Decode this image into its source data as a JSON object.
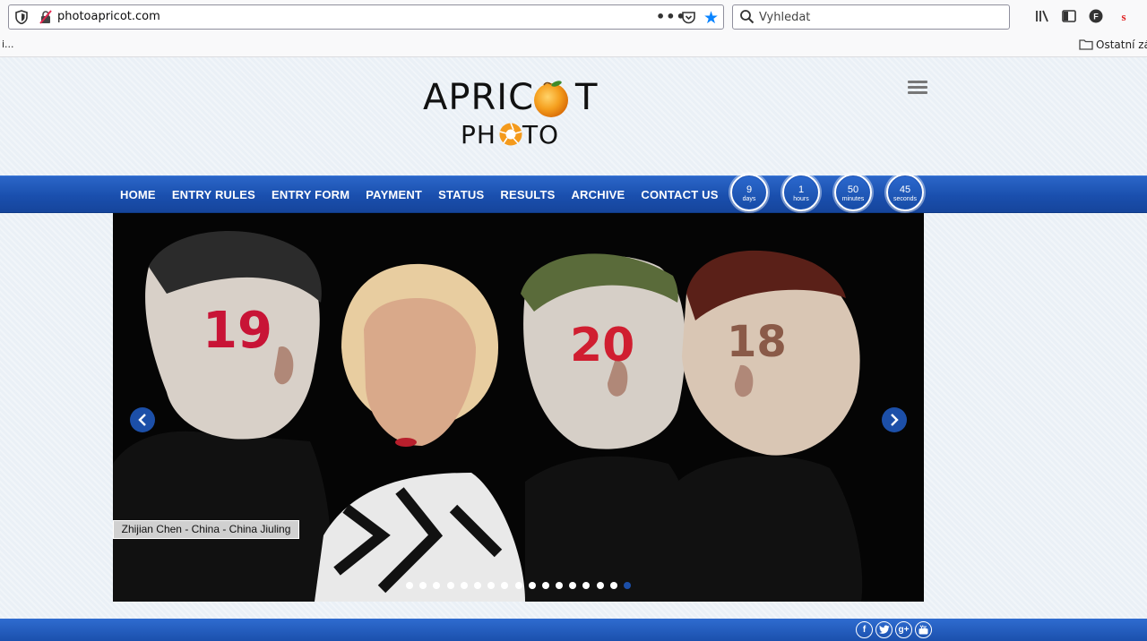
{
  "browser": {
    "url": "photoapricot.com",
    "more_label": "•••",
    "search_placeholder": "Vyhledat",
    "bookmarks_left": "i...",
    "bookmarks_other": "Ostatní zálo"
  },
  "header": {
    "logo_line1_a": "APRIC",
    "logo_line1_b": "T",
    "logo_line2_a": "PH",
    "logo_line2_b": "TO"
  },
  "nav": {
    "items": [
      {
        "label": "HOME"
      },
      {
        "label": "ENTRY RULES"
      },
      {
        "label": "ENTRY FORM"
      },
      {
        "label": "PAYMENT"
      },
      {
        "label": "STATUS"
      },
      {
        "label": "RESULTS"
      },
      {
        "label": "ARCHIVE"
      },
      {
        "label": "CONTACT US"
      }
    ]
  },
  "countdown": [
    {
      "value": "9",
      "unit": "days"
    },
    {
      "value": "1",
      "unit": "hours"
    },
    {
      "value": "50",
      "unit": "minutes"
    },
    {
      "value": "45",
      "unit": "seconds"
    }
  ],
  "slider": {
    "caption": "Zhijian Chen - China - China Jiuling",
    "total_slides": 17,
    "active_slide": 17,
    "hair_numbers": [
      "19",
      "20",
      "18"
    ]
  },
  "footer": {
    "social": [
      "f",
      "t",
      "g+",
      "yt"
    ]
  },
  "colors": {
    "nav_blue": "#1a4fae",
    "apricot": "#f49a1c",
    "active_dot": "#1c4fa8"
  }
}
